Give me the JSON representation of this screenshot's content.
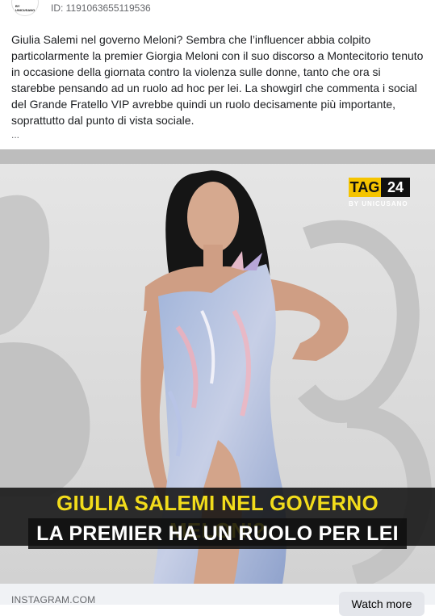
{
  "post": {
    "avatar_text": "BY UNICUSANO",
    "id_text": "ID: 1191063655119536",
    "body": "Giulia Salemi nel governo Meloni? Sembra che l’influencer abbia colpito particolarmente la premier Giorgia Meloni con il suo discorso a Montecitorio tenuto in occasione della giornata contro la violenza sulle donne, tanto che ora si starebbe pensando ad un ruolo ad hoc per lei. La showgirl che commenta i social del Grande Fratello VIP avrebbe quindi un ruolo decisamente più importante, soprattutto dal punto di vista sociale.",
    "ellipsis": "..."
  },
  "media": {
    "logo_tag": "TAG",
    "logo_num": "24",
    "logo_sub": "BY UNICUSANO",
    "caption_line1": "GIULIA SALEMI NEL GOVERNO MELONI?",
    "caption_line2": "LA PREMIER HA UN RUOLO PER LEI",
    "colors": {
      "caption_yellow": "#f2dc1b",
      "logo_yellow": "#f5c400",
      "caption_bg": "#0f0f0f"
    }
  },
  "footer": {
    "source": "INSTAGRAM.COM",
    "watch_more_label": "Watch more"
  }
}
